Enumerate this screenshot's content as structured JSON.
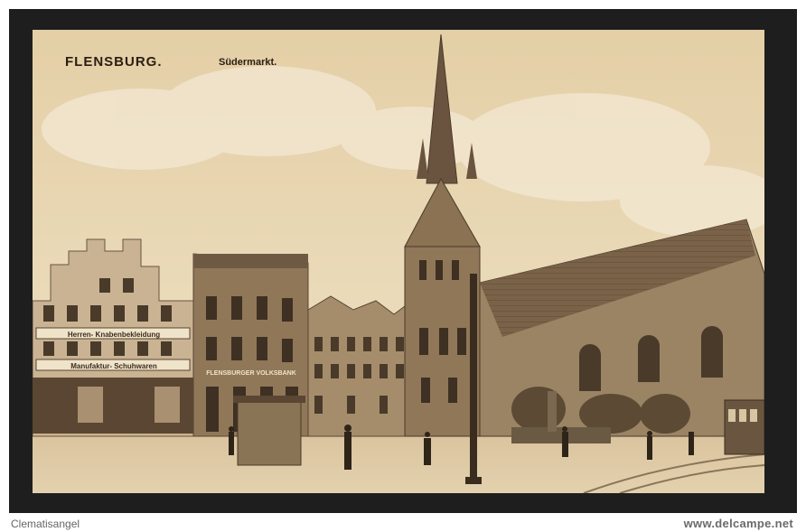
{
  "caption": {
    "city": "FLENSBURG.",
    "place": "Südermarkt."
  },
  "footer": {
    "left_text": "Clematisangel",
    "right_text": "www.delcampe.net"
  },
  "shop_signs": {
    "sign1": "Herren- Knabenbekleidung",
    "sign2": "Manufaktur- Schuhwaren",
    "sign3": "FLENSBURGER VOLKSBANK"
  },
  "colors": {
    "frame": "#1e1e1e",
    "sepia_sky": "#eadbb8",
    "sepia_dark": "#5a4632"
  }
}
